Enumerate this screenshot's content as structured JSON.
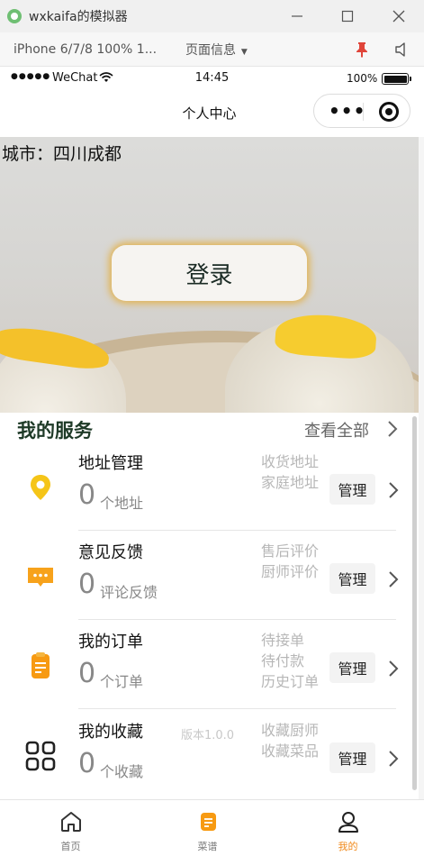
{
  "window": {
    "title": "wxkaifa的模拟器"
  },
  "toolbar": {
    "device": "iPhone 6/7/8 100% 1...",
    "page_info": "页面信息"
  },
  "status_bar": {
    "carrier": "WeChat",
    "time": "14:45",
    "battery": "100%"
  },
  "nav": {
    "title": "个人中心"
  },
  "hero": {
    "city": "城市：四川成都",
    "login_label": "登录"
  },
  "services": {
    "title": "我的服务",
    "view_all": "查看全部",
    "manage_label": "管理",
    "version": "版本1.0.0",
    "items": [
      {
        "name": "地址管理",
        "count": "0",
        "unit": "个地址",
        "tags": [
          "收货地址",
          "家庭地址"
        ],
        "icon": "location-pin-icon",
        "color": "#f5c518"
      },
      {
        "name": "意见反馈",
        "count": "0",
        "unit": "评论反馈",
        "tags": [
          "售后评价",
          "厨师评价"
        ],
        "icon": "chat-bubble-icon",
        "color": "#f7a21b"
      },
      {
        "name": "我的订单",
        "count": "0",
        "unit": "个订单",
        "tags": [
          "待接单",
          "待付款",
          "历史订单"
        ],
        "icon": "clipboard-icon",
        "color": "#f79a12"
      },
      {
        "name": "我的收藏",
        "count": "0",
        "unit": "个收藏",
        "tags": [
          "收藏厨师",
          "收藏菜品"
        ],
        "icon": "grid-icon",
        "color": "#222222"
      }
    ]
  },
  "tabbar": {
    "items": [
      {
        "label": "首页",
        "icon": "home-icon",
        "active": false
      },
      {
        "label": "菜谱",
        "icon": "recipe-icon",
        "active": false
      },
      {
        "label": "我的",
        "icon": "user-icon",
        "active": true
      }
    ],
    "active_color": "#f08a1c"
  }
}
